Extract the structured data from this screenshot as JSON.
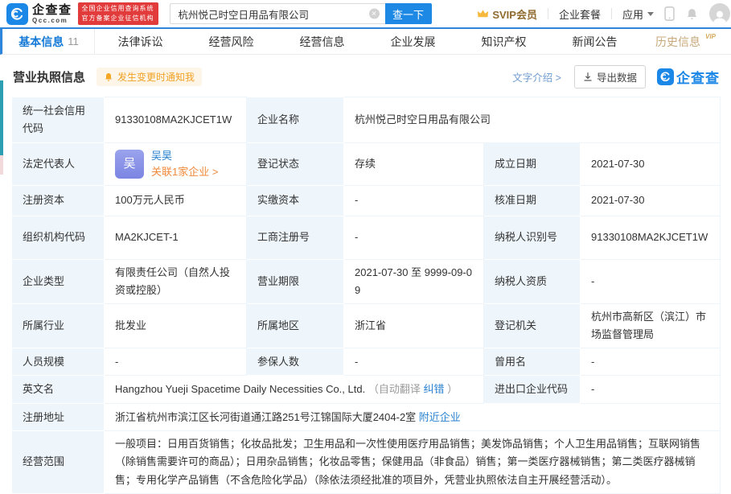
{
  "topbar": {
    "brand": "企查查",
    "brand_sub": "Qcc.com",
    "badge_line1": "全国企业信用查询系统",
    "badge_line2": "官方备案企业征信机构",
    "search_value": "杭州悦己时空日用品有限公司",
    "search_button": "查一下",
    "svip": "SVIP会员",
    "package": "企业套餐",
    "apps": "应用"
  },
  "tabs": [
    {
      "label": "基本信息",
      "count": "11"
    },
    {
      "label": "法律诉讼"
    },
    {
      "label": "经营风险"
    },
    {
      "label": "经营信息"
    },
    {
      "label": "企业发展"
    },
    {
      "label": "知识产权"
    },
    {
      "label": "新闻公告"
    },
    {
      "label": "历史信息",
      "vip": "VIP"
    }
  ],
  "section": {
    "title": "营业执照信息",
    "notify": "发生变更时通知我",
    "text_intro": "文字介绍 >",
    "export_btn": "导出数据",
    "watermark": "企查查"
  },
  "license": {
    "credit_code": {
      "label": "统一社会信用代码",
      "value": "91330108MA2KJCET1W"
    },
    "company_name": {
      "label": "企业名称",
      "value": "杭州悦己时空日用品有限公司"
    },
    "legal_rep": {
      "label": "法定代表人",
      "avatar": "吴",
      "name": "吴昊",
      "related": "关联1家企业 >"
    },
    "reg_status": {
      "label": "登记状态",
      "value": "存续"
    },
    "establish_date": {
      "label": "成立日期",
      "value": "2021-07-30"
    },
    "reg_capital": {
      "label": "注册资本",
      "value": "100万元人民币"
    },
    "paid_capital": {
      "label": "实缴资本",
      "value": "-"
    },
    "approval_date": {
      "label": "核准日期",
      "value": "2021-07-30"
    },
    "org_code": {
      "label": "组织机构代码",
      "value": "MA2KJCET-1"
    },
    "biz_reg_no": {
      "label": "工商注册号",
      "value": "-"
    },
    "taxpayer_id": {
      "label": "纳税人识别号",
      "value": "91330108MA2KJCET1W"
    },
    "company_type": {
      "label": "企业类型",
      "value": "有限责任公司（自然人投资或控股）"
    },
    "biz_term": {
      "label": "营业期限",
      "value": "2021-07-30 至 9999-09-09"
    },
    "taxpayer_qualification": {
      "label": "纳税人资质",
      "value": "-"
    },
    "industry": {
      "label": "所属行业",
      "value": "批发业"
    },
    "region": {
      "label": "所属地区",
      "value": "浙江省"
    },
    "reg_authority": {
      "label": "登记机关",
      "value": "杭州市高新区（滨江）市场监督管理局"
    },
    "staff_size": {
      "label": "人员规模",
      "value": "-"
    },
    "insured_count": {
      "label": "参保人数",
      "value": "-"
    },
    "former_name": {
      "label": "曾用名",
      "value": "-"
    },
    "english_name": {
      "label": "英文名",
      "value": "Hangzhou Yueji Spacetime Daily Necessities Co., Ltd.",
      "note_open": "（自动翻译",
      "correct": "纠错",
      "note_close": "）"
    },
    "import_export_code": {
      "label": "进出口企业代码",
      "value": "-"
    },
    "reg_address": {
      "label": "注册地址",
      "value": "浙江省杭州市滨江区长河街道通江路251号江锦国际大厦2404-2室",
      "nearby": "附近企业"
    },
    "biz_scope": {
      "label": "经营范围",
      "value": "一般项目：日用百货销售；化妆品批发；卫生用品和一次性使用医疗用品销售；美发饰品销售；个人卫生用品销售；互联网销售（除销售需要许可的商品）；日用杂品销售；化妆品零售；保健用品（非食品）销售；第一类医疗器械销售；第二类医疗器械销售；专用化学产品销售（不含危险化学品）（除依法须经批准的项目外，凭营业执照依法自主开展经营活动）。"
    }
  }
}
